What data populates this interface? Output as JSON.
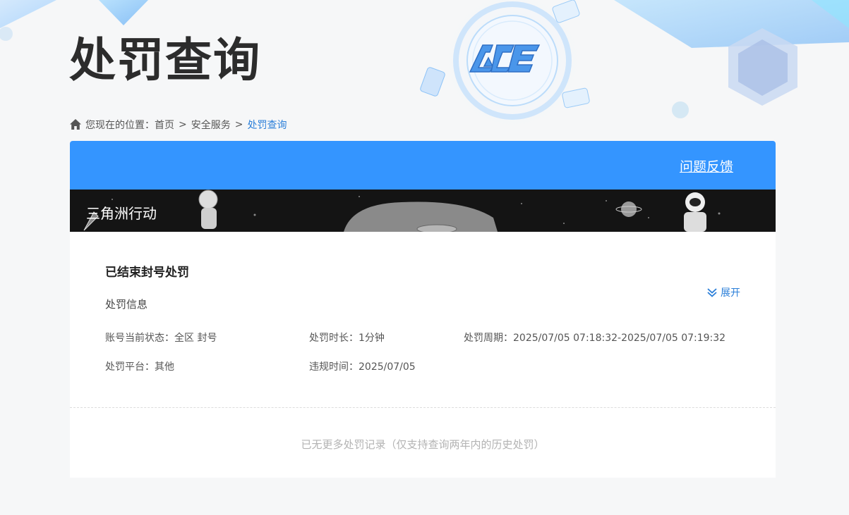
{
  "page": {
    "title": "处罚查询"
  },
  "breadcrumb": {
    "prefix": "您现在的位置：",
    "items": [
      "首页",
      "安全服务",
      "处罚查询"
    ],
    "separator": ">"
  },
  "card": {
    "feedback_label": "问题反馈",
    "game_name": "三角洲行动"
  },
  "record": {
    "status_title": "已结束封号处罚",
    "section_label": "处罚信息",
    "fields": {
      "account_status": "账号当前状态：全区 封号",
      "duration": "处罚时长：1分钟",
      "period": "处罚周期：2025/07/05 07:18:32-2025/07/05 07:19:32",
      "platform": "处罚平台：其他",
      "violation_time": "违规时间：2025/07/05"
    },
    "expand_label": "展开"
  },
  "footer": {
    "no_more": "已无更多处罚记录（仅支持查询两年内的历史处罚）"
  },
  "colors": {
    "accent": "#3495ff",
    "link": "#2b7fd9",
    "banner_bg": "#141414"
  },
  "icons": {
    "home": "home-icon",
    "expand": "double-chevron-down-icon",
    "logo": "ace-logo"
  }
}
